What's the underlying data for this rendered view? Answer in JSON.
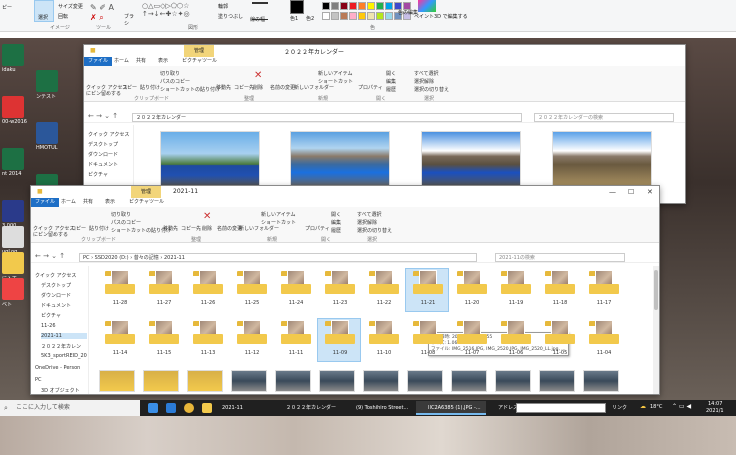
{
  "paint": {
    "copy": "ピー",
    "select": "選択",
    "resize": "サイズ変更",
    "rotate": "回転",
    "brush": "ブラシ",
    "outline": "輪郭",
    "fill": "塗りつぶし",
    "line_width": "線の幅",
    "color1": "色1",
    "color2": "色2",
    "edit_colors": "色の編集",
    "paint3d": "ペイント3D で編集する",
    "group_image": "イメージ",
    "group_tools": "ツール",
    "group_shapes": "図形",
    "group_colors": "色",
    "swatches": [
      "#000000",
      "#7f7f7f",
      "#880015",
      "#ed1c24",
      "#ff7f27",
      "#fff200",
      "#22b14c",
      "#00a2e8",
      "#3f48cc",
      "#a349a4",
      "#ffffff",
      "#c3c3c3",
      "#b97a57",
      "#ffaec9",
      "#ffc90e",
      "#efe4b0",
      "#b5e61d",
      "#99d9ea",
      "#7092be",
      "#c8bfe7"
    ]
  },
  "desktop": {
    "icons": [
      {
        "label": "idaku",
        "icon_name": "excel-icon"
      },
      {
        "label": "ンテスト",
        "icon_name": "excel-icon"
      },
      {
        "label": "00-w2016",
        "icon_name": "pdf-icon"
      },
      {
        "label": "HMOTUL",
        "icon_name": "word-icon"
      },
      {
        "label": "nt 2014",
        "icon_name": "excel-icon"
      },
      {
        "label": "収容プル",
        "icon_name": "excel-icon"
      },
      {
        "label": "3.000",
        "icon_name": "app-icon"
      },
      {
        "label": "ugLog",
        "icon_name": "file-icon"
      },
      {
        "label": "に入て",
        "icon_name": "folder-icon"
      },
      {
        "label": "ベト",
        "icon_name": "shield-icon"
      }
    ]
  },
  "win_back": {
    "title": "２０２２年カレンダー",
    "manage_tab": "管理",
    "tabs": [
      "ファイル",
      "ホーム",
      "共有",
      "表示",
      "ピクチャツール"
    ],
    "ribbon": {
      "quick_access": "クイック アクセス",
      "quick_access2": "にピン留めする",
      "copy": "コピー",
      "paste": "貼り付け",
      "cut": "切り取り",
      "copy_path": "パスのコピー",
      "paste_shortcut": "ショートカットの貼り付け",
      "move_to": "移動先",
      "copy_to": "コピー先",
      "delete": "削除",
      "rename": "名前の変更",
      "new_folder": "新しいフォルダー",
      "new_item": "新しいアイテム",
      "shortcut": "ショートカット",
      "properties": "プロパティ",
      "open": "開く",
      "edit": "編集",
      "history": "履歴",
      "select_all": "すべて選択",
      "select_none": "選択解除",
      "invert": "選択の切り替え",
      "group_clipboard": "クリップボード",
      "group_organize": "整理",
      "group_new": "新規",
      "group_open": "開く",
      "group_select": "選択"
    },
    "path": "２０２２年カレンダー",
    "search_placeholder": "２０２２年カレンダーの検索",
    "nav": {
      "quick": "クイック アクセス",
      "desktop": "デスクトップ",
      "downloads": "ダウンロード",
      "documents": "ドキュメント",
      "pictures": "ピクチャ"
    }
  },
  "win_front": {
    "title": "2021-11",
    "manage_tab": "管理",
    "tabs": [
      "ファイル",
      "ホーム",
      "共有",
      "表示",
      "ピクチャツール"
    ],
    "ribbon": {
      "quick_access": "クイック アクセス",
      "quick_access2": "にピン留めする",
      "copy": "コピー",
      "paste": "貼り付け",
      "cut": "切り取り",
      "copy_path": "パスのコピー",
      "paste_shortcut": "ショートカットの貼り付け",
      "move_to": "移動先",
      "copy_to": "コピー先",
      "delete": "削除",
      "rename": "名前の変更",
      "new_folder": "新しいフォルダー",
      "new_item": "新しいアイテム",
      "shortcut": "ショートカット",
      "properties": "プロパティ",
      "open": "開く",
      "edit": "編集",
      "history": "履歴",
      "select_all": "すべて選択",
      "select_none": "選択解除",
      "invert": "選択の切り替え",
      "group_clipboard": "クリップボード",
      "group_organize": "整理",
      "group_new": "新規",
      "group_open": "開く",
      "group_select": "選択"
    },
    "breadcrumb": "PC › SSD2020 (D:) › 昔々の記憶 › 2021-11",
    "search_placeholder": "2021-11の検索",
    "nav": {
      "quick": "クイック アクセス",
      "desktop": "デスクトップ",
      "downloads": "ダウンロード",
      "documents": "ドキュメント",
      "pictures": "ピクチャ",
      "f1": "11-26",
      "f2": "2021-11",
      "f3": "２０２２年カレン",
      "f4": "5K3_sportREID_20",
      "onedrive": "OneDrive - Person",
      "pc": "PC",
      "objects": "3D オブジェクト"
    },
    "row1": [
      "11-28",
      "11-27",
      "11-26",
      "11-25",
      "11-24",
      "11-23",
      "11-22",
      "11-21",
      "11-20",
      "11-19",
      "11-18",
      "11-17"
    ],
    "row2": [
      "11-14",
      "11-15",
      "11-13",
      "11-12",
      "11-11",
      "11-09",
      "11-10",
      "11-08",
      "11-07",
      "11-06",
      "11-05",
      "11-04"
    ],
    "tooltip": {
      "line1": "作成日時: 2021/11/21 15:55",
      "line2": "サイズ: 1.06 GB",
      "line3": "ファイル: IMG_2516.JPG, IMG_2520.JPG, IMG_2520_LL.jpg, ..."
    }
  },
  "taskbar": {
    "search": "ここに入力して検索",
    "apps": [
      {
        "label": "2021-11",
        "active": false
      },
      {
        "label": "２０２２年カレンダー",
        "active": false
      },
      {
        "label": "(9) Toshihiro Street...",
        "active": false
      },
      {
        "label": "IIC2A6385 (1).JPG -...",
        "active": true
      }
    ],
    "address_label": "アドレス",
    "link_label": "リンク",
    "temperature": "18°C",
    "time": "14:07",
    "date": "2021/1"
  }
}
